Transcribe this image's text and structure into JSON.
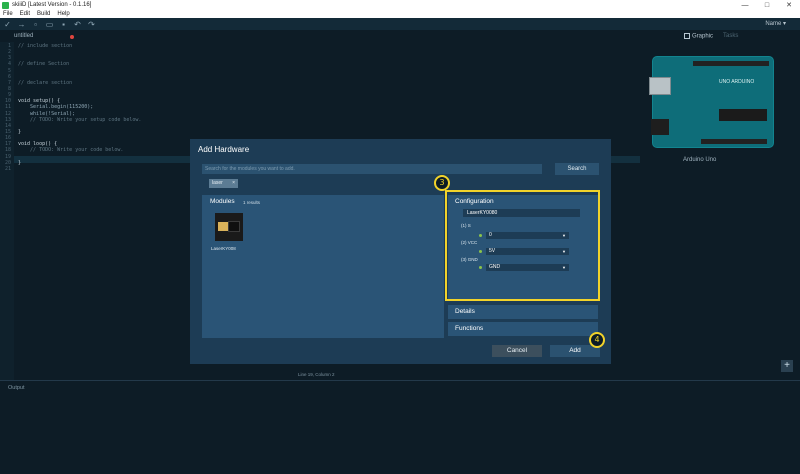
{
  "window": {
    "title": "skiiiD [Latest Version - 0.1.16]",
    "controls": [
      "—",
      "□",
      "✕"
    ]
  },
  "menu": [
    "File",
    "Edit",
    "Build",
    "Help"
  ],
  "toolbar": {
    "icons": [
      "check-icon",
      "upload-icon",
      "new-file-icon",
      "open-folder-icon",
      "save-icon",
      "undo-icon",
      "redo-icon"
    ],
    "name_menu": "Name ▾"
  },
  "editor": {
    "tab": "untitled",
    "lines": [
      {
        "n": "1",
        "text": "// include section",
        "kind": "comment"
      },
      {
        "n": "2",
        "text": "",
        "kind": "comment"
      },
      {
        "n": "3",
        "text": "",
        "kind": "comment"
      },
      {
        "n": "4",
        "text": "// define Section",
        "kind": "comment"
      },
      {
        "n": "5",
        "text": "",
        "kind": "comment"
      },
      {
        "n": "6",
        "text": "",
        "kind": "comment"
      },
      {
        "n": "7",
        "text": "// declare section",
        "kind": "comment"
      },
      {
        "n": "8",
        "text": "",
        "kind": "comment"
      },
      {
        "n": "9",
        "text": "",
        "kind": "comment"
      },
      {
        "n": "10",
        "text": "void setup() {",
        "kind": "kw"
      },
      {
        "n": "11",
        "text": "    Serial.begin(115200);",
        "kind": "sub"
      },
      {
        "n": "12",
        "text": "    while(!Serial);",
        "kind": "sub"
      },
      {
        "n": "13",
        "text": "    // TODO: Write your setup code below.",
        "kind": "comment"
      },
      {
        "n": "14",
        "text": "",
        "kind": "comment"
      },
      {
        "n": "15",
        "text": "}",
        "kind": "kw"
      },
      {
        "n": "16",
        "text": "",
        "kind": "comment"
      },
      {
        "n": "17",
        "text": "void loop() {",
        "kind": "kw"
      },
      {
        "n": "18",
        "text": "    // TODO: Write your code below.",
        "kind": "comment"
      },
      {
        "n": "19",
        "text": "",
        "kind": "comment"
      },
      {
        "n": "20",
        "text": "}",
        "kind": "kw"
      },
      {
        "n": "21",
        "text": "",
        "kind": "comment"
      }
    ]
  },
  "right_panel": {
    "tab_graphic": "Graphic",
    "tab_tasks": "Tasks",
    "board_label": "Arduino Uno",
    "board_logo": "UNO ARDUINO"
  },
  "status": {
    "cursor": "Line 19, Column 2"
  },
  "output": {
    "label": "Output"
  },
  "modal": {
    "title": "Add Hardware",
    "search_placeholder": "Search for the modules you want to add.",
    "search_button": "Search",
    "tag": "laser",
    "modules_title": "Modules",
    "modules_count": "1 results",
    "module_name": "LaserKY008",
    "configuration_title": "Configuration",
    "config_name": "LaserKY0080",
    "pins": [
      {
        "label": "(1) S",
        "value": "0"
      },
      {
        "label": "(2) VCC",
        "value": "5V"
      },
      {
        "label": "(3) GND",
        "value": "GND"
      }
    ],
    "details_label": "Details",
    "functions_label": "Functions",
    "cancel_button": "Cancel",
    "add_button": "Add"
  },
  "annotations": {
    "step_config": "3",
    "step_add": "4"
  },
  "colors": {
    "accent": "#f2d32a",
    "modal_bg": "#1d3c55",
    "panel_bg": "#2a5476"
  }
}
